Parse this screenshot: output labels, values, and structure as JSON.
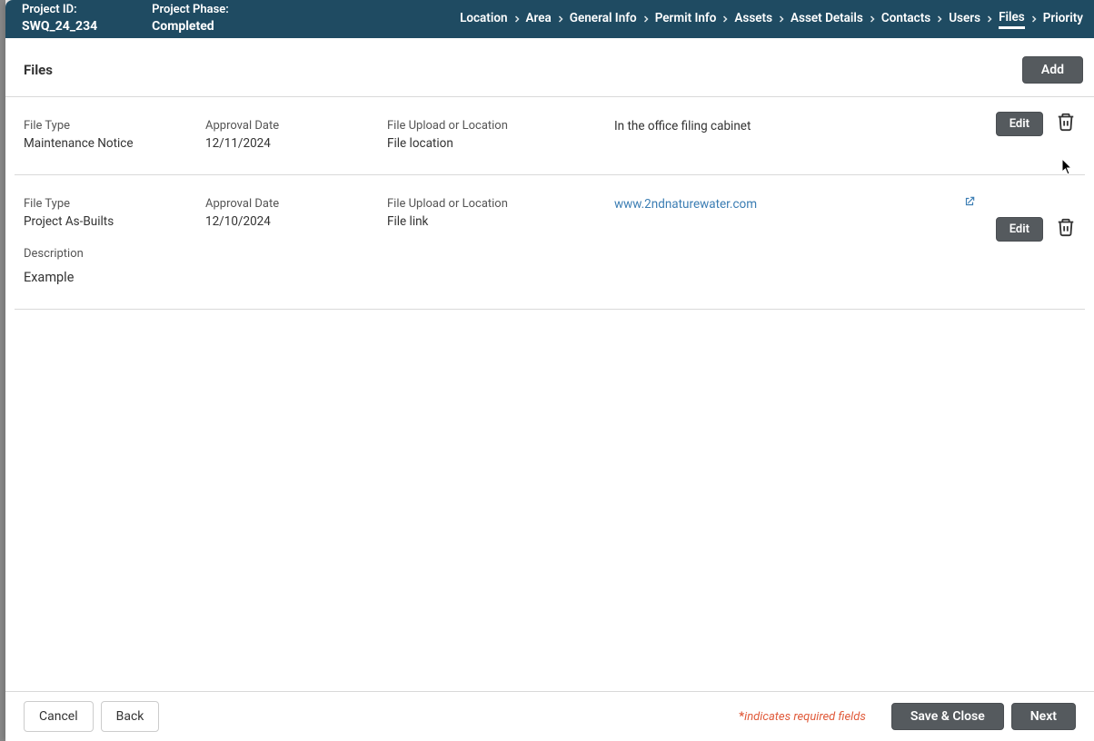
{
  "header": {
    "projectIdLabel": "Project ID:",
    "projectIdValue": "SWQ_24_234",
    "projectPhaseLabel": "Project Phase:",
    "projectPhaseValue": "Completed"
  },
  "breadcrumb": {
    "items": [
      {
        "label": "Location",
        "active": false
      },
      {
        "label": "Area",
        "active": false
      },
      {
        "label": "General Info",
        "active": false
      },
      {
        "label": "Permit Info",
        "active": false
      },
      {
        "label": "Assets",
        "active": false
      },
      {
        "label": "Asset Details",
        "active": false
      },
      {
        "label": "Contacts",
        "active": false
      },
      {
        "label": "Users",
        "active": false
      },
      {
        "label": "Files",
        "active": true
      },
      {
        "label": "Priority",
        "active": false
      }
    ]
  },
  "section": {
    "title": "Files",
    "addLabel": "Add"
  },
  "labels": {
    "fileType": "File Type",
    "approvalDate": "Approval Date",
    "fileUploadOrLocation": "File Upload or Location",
    "description": "Description",
    "edit": "Edit"
  },
  "files": [
    {
      "fileType": "Maintenance Notice",
      "approvalDate": "12/11/2024",
      "uploadKind": "File location",
      "info": "In the office filing cabinet",
      "isLink": false
    },
    {
      "fileType": "Project As-Builts",
      "approvalDate": "12/10/2024",
      "uploadKind": "File link",
      "info": "www.2ndnaturewater.com",
      "isLink": true,
      "description": "Example"
    }
  ],
  "footer": {
    "cancel": "Cancel",
    "back": "Back",
    "requiredNote": "indicates required fields",
    "saveClose": "Save & Close",
    "next": "Next"
  }
}
